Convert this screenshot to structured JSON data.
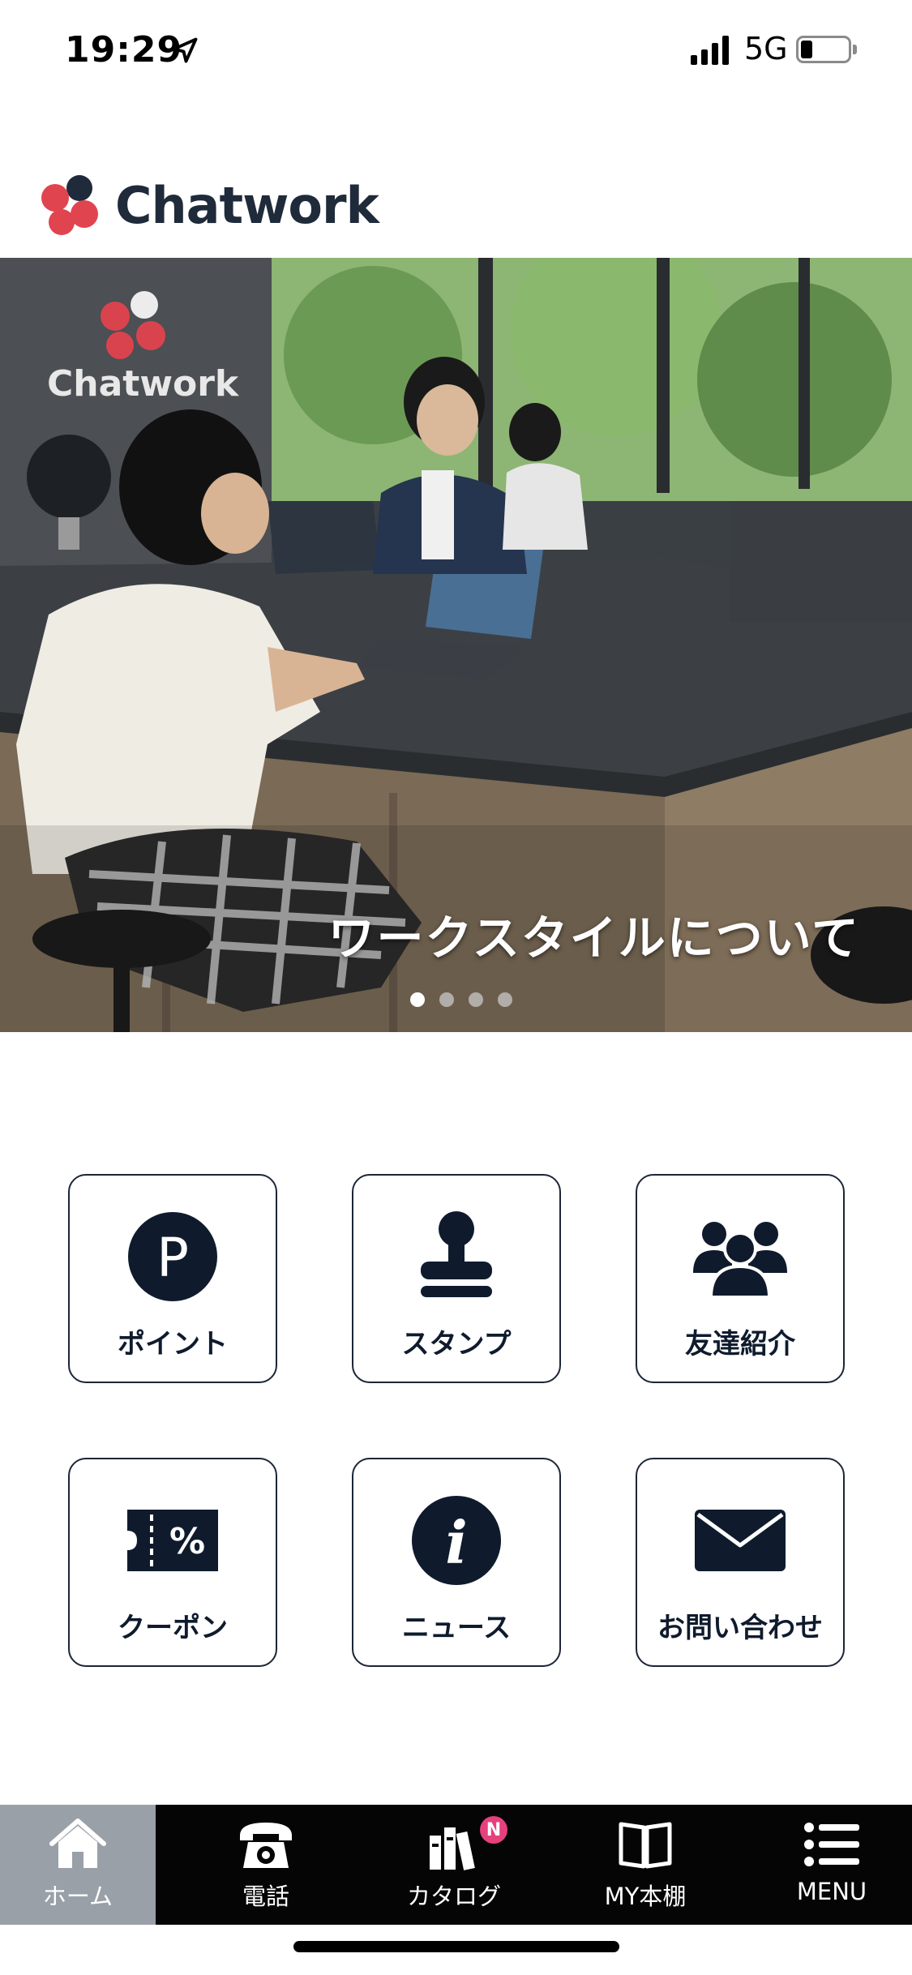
{
  "status_bar": {
    "time": "19:29",
    "network": "5G"
  },
  "brand": {
    "name": "Chatwork"
  },
  "hero": {
    "sign_text": "Chatwork",
    "caption": "ワークスタイルについて",
    "slides_count": 4,
    "active_slide": 1
  },
  "tiles": [
    {
      "label": "ポイント",
      "icon": "point-icon",
      "glyph": "P"
    },
    {
      "label": "スタンプ",
      "icon": "stamp-icon"
    },
    {
      "label": "友達紹介",
      "icon": "friends-icon"
    },
    {
      "label": "クーポン",
      "icon": "coupon-icon",
      "glyph": "%"
    },
    {
      "label": "ニュース",
      "icon": "info-icon",
      "glyph": "i"
    },
    {
      "label": "お問い合わせ",
      "icon": "mail-icon"
    }
  ],
  "tabbar": {
    "items": [
      {
        "label": "ホーム",
        "icon": "home-icon",
        "active": true
      },
      {
        "label": "電話",
        "icon": "phone-icon"
      },
      {
        "label": "カタログ",
        "icon": "catalog-icon",
        "badge": "N"
      },
      {
        "label": "MY本棚",
        "icon": "book-icon"
      },
      {
        "label": "MENU",
        "icon": "menu-icon"
      }
    ]
  },
  "colors": {
    "accent_dark": "#0f1b2d",
    "logo_red": "#e0444f",
    "logo_navy": "#1f2a3a",
    "tab_active_bg": "#9aa0a8",
    "badge": "#e6407d"
  }
}
